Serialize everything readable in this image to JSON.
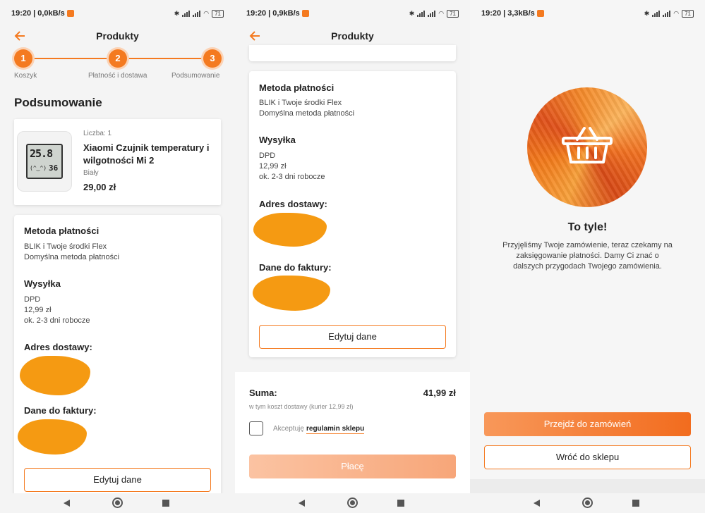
{
  "panel1": {
    "status": {
      "time": "19:20",
      "speed": "0,0kB/s",
      "battery": "71"
    },
    "title": "Produkty",
    "steps": [
      {
        "num": "1",
        "label": "Koszyk"
      },
      {
        "num": "2",
        "label": "Płatność i dostawa"
      },
      {
        "num": "3",
        "label": "Podsumowanie"
      }
    ],
    "heading": "Podsumowanie",
    "product": {
      "qty": "Liczba: 1",
      "name": "Xiaomi Czujnik temperatury i wilgotności Mi 2",
      "variant": "Biały",
      "price": "29,00 zł",
      "display_temp": "25.8",
      "display_hum": "36"
    },
    "payment": {
      "title": "Metoda płatności",
      "line1": "BLIK i Twoje środki Flex",
      "line2": "Domyślna metoda płatności"
    },
    "shipping": {
      "title": "Wysyłka",
      "line1": "DPD",
      "line2": "12,99 zł",
      "line3": "ok. 2-3 dni robocze"
    },
    "address_title": "Adres dostawy:",
    "invoice_title": "Dane do faktury:",
    "edit_label": "Edytuj dane"
  },
  "panel2": {
    "status": {
      "time": "19:20",
      "speed": "0,9kB/s",
      "battery": "71"
    },
    "title": "Produkty",
    "payment": {
      "title": "Metoda płatności",
      "line1": "BLIK i Twoje środki Flex",
      "line2": "Domyślna metoda płatności"
    },
    "shipping": {
      "title": "Wysyłka",
      "line1": "DPD",
      "line2": "12,99 zł",
      "line3": "ok. 2-3 dni robocze"
    },
    "address_title": "Adres dostawy:",
    "invoice_title": "Dane do faktury:",
    "edit_label": "Edytuj dane",
    "sum_label": "Suma:",
    "sum_value": "41,99 zł",
    "sum_note": "w tym koszt dostawy (kurier 12,99 zł)",
    "accept_label": "Akceptuję",
    "terms_link": "regulamin sklepu",
    "pay_label": "Płacę"
  },
  "panel3": {
    "status": {
      "time": "19:20",
      "speed": "3,3kB/s",
      "battery": "71"
    },
    "success_title": "To tyle!",
    "success_text": "Przyjęliśmy Twoje zamówienie, teraz czekamy na zaksięgowanie płatności. Damy Ci znać o dalszych przygodach Twojego zamówienia.",
    "orders_button": "Przejdź do zamówień",
    "shop_button": "Wróć do sklepu"
  },
  "colors": {
    "accent": "#f47a20",
    "pay_disabled": "#f8b58e"
  },
  "icons": [
    "back-arrow-icon",
    "basket-icon",
    "bluetooth-icon",
    "wifi-icon",
    "battery-icon",
    "nav-back-icon",
    "nav-home-icon",
    "nav-recents-icon"
  ]
}
